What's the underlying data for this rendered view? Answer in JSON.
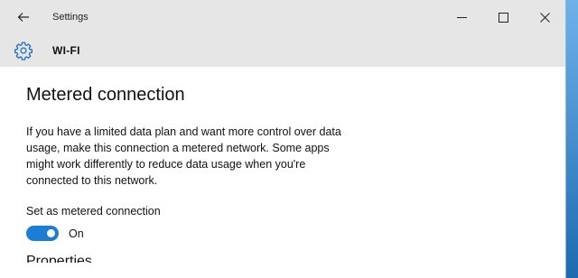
{
  "window": {
    "title": "Settings"
  },
  "header": {
    "title": "WI-FI"
  },
  "main": {
    "page_title": "Metered connection",
    "description": "If you have a limited data plan and want more control over data usage, make this connection a metered network. Some apps might work differently to reduce data usage when you're connected to this network.",
    "metered_toggle": {
      "label": "Set as metered connection",
      "state": "On",
      "on": true
    },
    "next_section_partial": "Properties"
  },
  "colors": {
    "accent": "#1a7dd6",
    "titlebar": "#e6e6e6"
  },
  "icons": {
    "back": "back-arrow-icon",
    "minimize": "minimize-icon",
    "maximize": "maximize-icon",
    "close": "close-icon",
    "settings": "gear-icon"
  }
}
